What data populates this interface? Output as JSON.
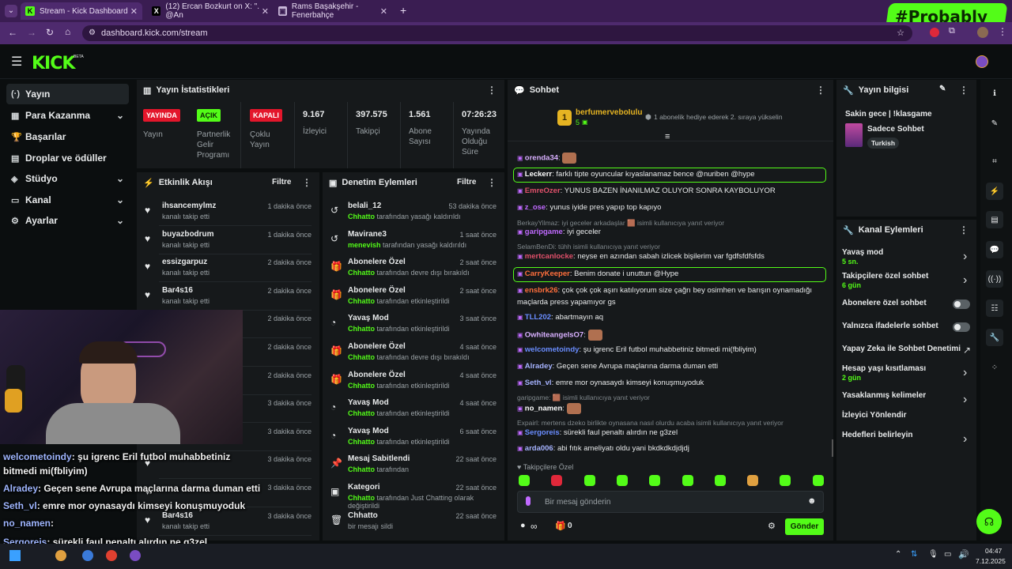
{
  "browser": {
    "tabs": [
      {
        "title": "Stream - Kick Dashboard",
        "favicon": "K"
      },
      {
        "title": "(12) Ercan Bozkurt on X: \". @An",
        "favicon": "X"
      },
      {
        "title": "Rams Başakşehir - Fenerbahçe",
        "favicon": "▣"
      }
    ],
    "new_tab": "+",
    "url": "dashboard.kick.com/stream",
    "watermark": "#Probably"
  },
  "header": {
    "logo": "KICK",
    "logo_sup": "BETA"
  },
  "nav": {
    "items": [
      {
        "label": "Yayın",
        "icon": "(·)",
        "chevron": ""
      },
      {
        "label": "Para Kazanma",
        "icon": "▦",
        "chevron": "⌄"
      },
      {
        "label": "Başarılar",
        "icon": "🏆",
        "chevron": ""
      },
      {
        "label": "Droplar ve ödüller",
        "icon": "▤",
        "chevron": ""
      },
      {
        "label": "Stüdyo",
        "icon": "◈",
        "chevron": "⌄"
      },
      {
        "label": "Kanal",
        "icon": "▭",
        "chevron": "⌄"
      },
      {
        "label": "Ayarlar",
        "icon": "⚙",
        "chevron": "⌄"
      }
    ]
  },
  "stats": {
    "title": "Yayın İstatistikleri",
    "badges": [
      {
        "text": "YAYINDA",
        "label": "Yayın"
      },
      {
        "text": "AÇIK",
        "label": "Partnerlik Gelir Programı"
      },
      {
        "text": "KAPALI",
        "label": "Çoklu Yayın"
      }
    ],
    "numbers": [
      {
        "value": "9.167",
        "label": "İzleyici"
      },
      {
        "value": "397.575",
        "label": "Takipçi"
      },
      {
        "value": "1.561",
        "label": "Abone Sayısı"
      },
      {
        "value": "07:26:23",
        "label": "Yayında Olduğu Süre"
      }
    ]
  },
  "activity": {
    "title": "Etkinlik Akışı",
    "filter": "Filtre",
    "rows": [
      {
        "name": "ihsancemylmz",
        "sub": "kanalı takip etti",
        "time": "1 dakika önce"
      },
      {
        "name": "buyazbodrum",
        "sub": "kanalı takip etti",
        "time": "1 dakika önce"
      },
      {
        "name": "essizgarpuz",
        "sub": "kanalı takip etti",
        "time": "2 dakika önce"
      },
      {
        "name": "Bar4s16",
        "sub": "kanalı takip etti",
        "time": "2 dakika önce"
      },
      {
        "name": "",
        "sub": "",
        "time": "2 dakika önce"
      },
      {
        "name": "",
        "sub": "",
        "time": "2 dakika önce"
      },
      {
        "name": "",
        "sub": "",
        "time": "2 dakika önce"
      },
      {
        "name": "",
        "sub": "",
        "time": "3 dakika önce"
      },
      {
        "name": "",
        "sub": "",
        "time": "3 dakika önce"
      },
      {
        "name": "",
        "sub": "",
        "time": "3 dakika önce"
      },
      {
        "name": "",
        "sub": "",
        "time": "3 dakika önce"
      },
      {
        "name": "Bar4s16",
        "sub": "kanalı takip etti",
        "time": "3 dakika önce"
      }
    ]
  },
  "moderation": {
    "title": "Denetim Eylemleri",
    "filter": "Filtre",
    "rows": [
      {
        "name": "belali_12",
        "actor": "Chhatto",
        "sub": " tarafından yasağı kaldırıldı",
        "time": "53 dakika önce",
        "icon": "↺"
      },
      {
        "name": "Mavirane3",
        "actor": "menevish",
        "sub": " tarafından yasağı kaldırıldı",
        "time": "1 saat önce",
        "icon": "↺"
      },
      {
        "name": "Abonelere Özel",
        "actor": "Chhatto",
        "sub": " tarafından devre dışı bırakıldı",
        "time": "2 saat önce",
        "icon": "🎁"
      },
      {
        "name": "Abonelere Özel",
        "actor": "Chhatto",
        "sub": " tarafından etkinleştirildi",
        "time": "2 saat önce",
        "icon": "🎁"
      },
      {
        "name": "Yavaş Mod",
        "actor": "Chhatto",
        "sub": " tarafından etkinleştirildi",
        "time": "3 saat önce",
        "icon": "◔"
      },
      {
        "name": "Abonelere Özel",
        "actor": "Chhatto",
        "sub": " tarafından devre dışı bırakıldı",
        "time": "4 saat önce",
        "icon": "🎁"
      },
      {
        "name": "Abonelere Özel",
        "actor": "Chhatto",
        "sub": " tarafından etkinleştirildi",
        "time": "4 saat önce",
        "icon": "🎁"
      },
      {
        "name": "Yavaş Mod",
        "actor": "Chhatto",
        "sub": " tarafından etkinleştirildi",
        "time": "4 saat önce",
        "icon": "◔"
      },
      {
        "name": "Yavaş Mod",
        "actor": "Chhatto",
        "sub": " tarafından etkinleştirildi",
        "time": "6 saat önce",
        "icon": "◔"
      },
      {
        "name": "Mesaj Sabitlendi",
        "actor": "Chhatto",
        "sub": " tarafından",
        "time": "22 saat önce",
        "icon": "📌"
      },
      {
        "name": "Kategori",
        "actor": "Chhatto",
        "sub": " tarafından Just Chatting olarak değiştirildi",
        "time": "22 saat önce",
        "icon": "▣"
      },
      {
        "name": "Chhatto",
        "actor": "",
        "sub": "bir mesajı sildi",
        "time": "22 saat önce",
        "icon": "🗑"
      }
    ]
  },
  "chat": {
    "title": "Sohbet",
    "pinned_user": "berfumerveboIulu",
    "pinned_count": "5",
    "pinned_rank": "1",
    "pinned_text": "1 abonelik hediye ederek 2. sıraya yükselin",
    "messages": [
      {
        "user": "orenda34",
        "text": "",
        "color": "#d8b0ff"
      },
      {
        "user": "Leckerr",
        "text": "farklı tipte oyuncular kıyaslanamaz bence @nuriben @hype",
        "color": "#ffffff",
        "highlight": true
      },
      {
        "user": "EmreOzer",
        "text": "YUNUS BAZEN İNANILMAZ OLUYOR SONRA KAYBOLUYOR",
        "color": "#e0506a"
      },
      {
        "user": "z_ose",
        "text": "yunus iyide pres yapıp top kapıyo",
        "color": "#c06aff"
      },
      {
        "reply": "BerkayYilmaz: iyi geceler arkadaşlar 🟫 isimli kullanıcıya yanıt veriyor"
      },
      {
        "user": "garipgame",
        "text": "iyi geceler",
        "color": "#c06aff"
      },
      {
        "reply": "SelamBenDi: tühh isimli kullanıcıya yanıt veriyor"
      },
      {
        "user": "mertcanlocke",
        "text": "neyse en azından sabah izlicek bişilerim var fgdfsfdfsfds",
        "color": "#e0506a"
      },
      {
        "user": "CarryKeeper",
        "text": "Benim donate i unuttun @Hype",
        "color": "#ff6f3c",
        "highlight": true
      },
      {
        "user": "ensbrk26",
        "text": "çok çok çok aşırı katılıyorum size çağrı bey osimhen ve barışın oynamadığı",
        "color": "#ff6f3c"
      },
      {
        "user": "",
        "text": "maçlarda press yapamıyor gs",
        "color": "#ffffff"
      },
      {
        "user": "TLL202",
        "text": "abartmayın aq",
        "color": "#6a8dff"
      },
      {
        "user": "OwhiteangelsO7",
        "text": "",
        "color": "#d8b0ff"
      },
      {
        "user": "welcometoindy",
        "text": "şu igrenc Eril futbol muhabbetiniz bitmedi mi(fbliyim)",
        "color": "#6a8dff"
      },
      {
        "user": "Alradey",
        "text": "Geçen sene Avrupa maçlarına darma duman etti",
        "color": "#a6b3ff"
      },
      {
        "user": "Seth_vl",
        "text": "emre mor oynasaydı kimseyi konuşmuyoduk",
        "color": "#a6b3ff"
      },
      {
        "reply": "garipgame: 🟫 isimli kullanıcıya yanıt veriyor"
      },
      {
        "user": "no_namen",
        "text": "",
        "color": "#ffffff"
      },
      {
        "reply": "Expairl: mertens dzeko birlikte oynasana nasıl olurdu acaba isimli kullanıcıya yanıt veriyor"
      },
      {
        "user": "Sergoreis",
        "text": "sürekli faul penaltı alırdın ne g3zel",
        "color": "#6a8dff"
      },
      {
        "user": "arda006",
        "text": "abi fıtık ameliyatı oldu yani bkdkdkdjdjdj",
        "color": "#a6b3ff"
      }
    ],
    "follower_only": "Takipçilere Özel",
    "input_placeholder": "Bir mesaj gönderin",
    "points": "∞",
    "gift_count": "0",
    "send": "Gönder"
  },
  "info": {
    "title": "Yayın bilgisi",
    "stream_title": "Sakin gece | !klasgame",
    "category": "Sohbet",
    "category_prefix": "Sadece ",
    "tag": "Turkish"
  },
  "channel_actions": {
    "title": "Kanal Eylemleri",
    "items": [
      {
        "label": "Yavaş mod",
        "sub": "5 sn.",
        "control": "chevron"
      },
      {
        "label": "Takipçilere özel sohbet",
        "sub": "6 gün",
        "control": "chevron"
      },
      {
        "label": "Abonelere özel sohbet",
        "sub": "",
        "control": "toggle"
      },
      {
        "label": "Yalnızca ifadelerle sohbet",
        "sub": "",
        "control": "toggle"
      },
      {
        "label": "Yapay Zeka ile Sohbet Denetimi",
        "sub": "",
        "control": "external"
      },
      {
        "label": "Hesap yaşı kısıtlaması",
        "sub": "2 gün",
        "control": "chevron"
      },
      {
        "label": "Yasaklanmış kelimeler",
        "sub": "",
        "control": "chevron"
      },
      {
        "label": "İzleyici Yönlendir",
        "sub": "",
        "control": ""
      },
      {
        "label": "Hedefleri belirleyin",
        "sub": "",
        "control": "chevron"
      }
    ]
  },
  "overlay_chat": [
    {
      "user": "welcometoindy",
      "text": ": şu igrenc Eril futbol muhabbetiniz"
    },
    {
      "user": "",
      "text": "bitmedi mi(fbliyim)"
    },
    {
      "user": "Alradey",
      "text": ": Geçen sene Avrupa maçlarına darma duman etti"
    },
    {
      "user": "Seth_vl",
      "text": ": emre mor oynasaydı kimseyi konuşmuyoduk"
    },
    {
      "user": "no_namen",
      "text": ":"
    },
    {
      "user": "Sergoreis",
      "text": ": sürekli faul penaltı alırdın ne g3zel"
    },
    {
      "user": "arda006",
      "text": ": abi fıtık ameliyatı oldu yani bkdkdkdjdjdj"
    }
  ],
  "taskbar": {
    "time": "04:47",
    "date": "7.12.2025"
  },
  "colors": {
    "accent": "#53fc18",
    "live": "#e3162b",
    "panel": "#16191b",
    "bg": "#0b0e0f"
  }
}
